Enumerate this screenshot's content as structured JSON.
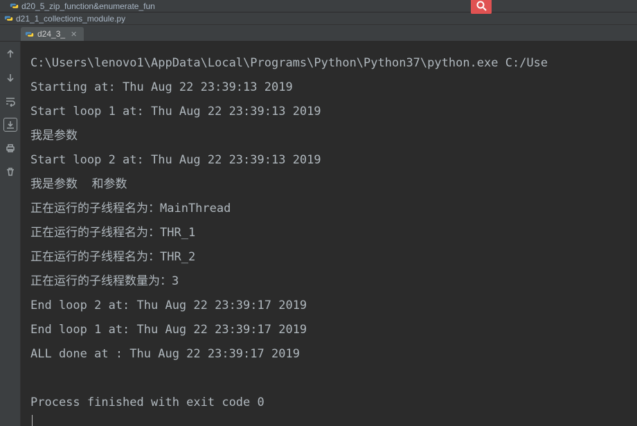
{
  "topFileTabs": {
    "tab1": "d20_5_zip_function&enumerate_fun",
    "tab2": "d21_1_collections_module.py"
  },
  "runTabs": {
    "active": {
      "label": "d24_3_"
    }
  },
  "console": {
    "lines": [
      "C:\\Users\\lenovo1\\AppData\\Local\\Programs\\Python\\Python37\\python.exe C:/Use",
      "Starting at: Thu Aug 22 23:39:13 2019",
      "Start loop 1 at: Thu Aug 22 23:39:13 2019",
      "我是参数",
      "Start loop 2 at: Thu Aug 22 23:39:13 2019",
      "我是参数  和参数",
      "正在运行的子线程名为：MainThread",
      "正在运行的子线程名为：THR_1",
      "正在运行的子线程名为：THR_2",
      "正在运行的子线程数量为：3",
      "End loop 2 at: Thu Aug 22 23:39:17 2019",
      "End loop 1 at: Thu Aug 22 23:39:17 2019",
      "ALL done at : Thu Aug 22 23:39:17 2019",
      "",
      "Process finished with exit code 0"
    ]
  },
  "icons": {
    "python": "python-icon",
    "search": "search-icon"
  }
}
